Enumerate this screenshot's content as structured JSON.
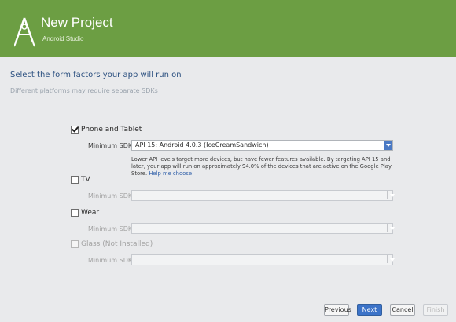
{
  "header": {
    "title": "New Project",
    "subtitle": "Android Studio",
    "brand_color": "#6c9e43",
    "logo_icon": "android-studio-logo-icon"
  },
  "prompt": "Select the form factors your app will run on",
  "help_text": "Different platforms may require separate SDKs",
  "form_factors": [
    {
      "label": "Phone and Tablet",
      "checked": true,
      "enabled": true,
      "min_sdk_label": "Minimum SDK",
      "min_sdk_value": "API 15: Android 4.0.3 (IceCreamSandwich)"
    },
    {
      "label": "TV",
      "checked": false,
      "enabled": true,
      "min_sdk_label": "Minimum SDK",
      "min_sdk_value": ""
    },
    {
      "label": "Wear",
      "checked": false,
      "enabled": true,
      "min_sdk_label": "Minimum SDK",
      "min_sdk_value": ""
    },
    {
      "label": "Glass (Not Installed)",
      "checked": false,
      "enabled": false,
      "min_sdk_label": "Minimum SDK",
      "min_sdk_value": ""
    }
  ],
  "info": {
    "text": "Lower API levels target more devices, but have fewer features available. By targeting API 15 and later, your app will run on approximately 94.0% of the devices that are active on the Google Play Store.",
    "link": "Help me choose"
  },
  "buttons": {
    "previous": "Previous",
    "next": "Next",
    "cancel": "Cancel",
    "finish": "Finish"
  }
}
